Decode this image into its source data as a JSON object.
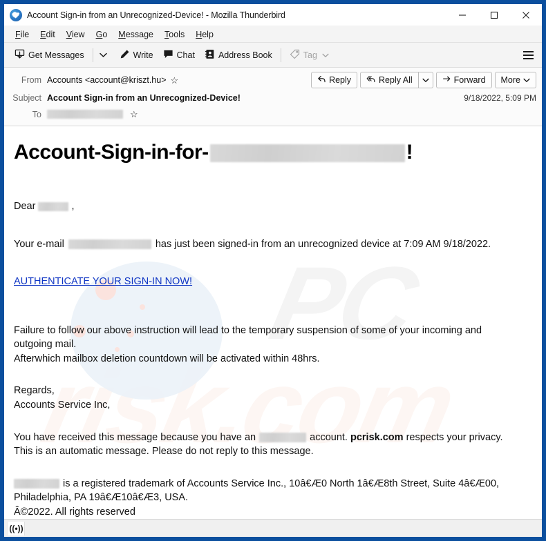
{
  "window": {
    "title": "Account Sign-in from an Unrecognized-Device! - Mozilla Thunderbird",
    "app_icon": "thunderbird-icon",
    "minimize_label": "–",
    "maximize_label": "□",
    "close_label": "✕",
    "frame_color": "#0b4f9e"
  },
  "menubar": {
    "items": [
      {
        "label": "File",
        "accel": "F"
      },
      {
        "label": "Edit",
        "accel": "E"
      },
      {
        "label": "View",
        "accel": "V"
      },
      {
        "label": "Go",
        "accel": "G"
      },
      {
        "label": "Message",
        "accel": "M"
      },
      {
        "label": "Tools",
        "accel": "T"
      },
      {
        "label": "Help",
        "accel": "H"
      }
    ]
  },
  "toolbar": {
    "get_messages": "Get Messages",
    "get_messages_caret": "⌄",
    "write": "Write",
    "chat": "Chat",
    "address_book": "Address Book",
    "tag": "Tag",
    "tag_caret": "⌄",
    "app_menu": "app-menu"
  },
  "message_header": {
    "from_label": "From",
    "from_value": "Accounts <account@kriszt.hu>",
    "subject_label": "Subject",
    "subject_value": "Account Sign-in from an Unrecognized-Device!",
    "to_label": "To",
    "to_value_redacted": true,
    "date": "9/18/2022, 5:09 PM",
    "star_glyph": "☆",
    "actions": {
      "reply": "Reply",
      "reply_all": "Reply All",
      "reply_all_caret": "⌄",
      "forward": "Forward",
      "more": "More",
      "more_caret": "⌄"
    }
  },
  "body": {
    "title_prefix": "Account-Sign-in-for-",
    "title_suffix": "!",
    "title_redacted": true,
    "greeting_prefix": "Dear",
    "greeting_suffix": ",",
    "line_email_prefix": "Your e-mail",
    "line_email_suffix": "has just been signed-in from an unrecognized device at 7:09 AM 9/18/2022.",
    "cta_link": "AUTHENTICATE YOUR SIGN-IN NOW!",
    "warning_line1": "Failure to follow our above instruction will lead to the temporary suspension of some of your incoming and",
    "warning_line2": "outgoing mail.",
    "warning_line3": "Afterwhich mailbox deletion countdown will be activated within 48hrs.",
    "regards": "Regards,",
    "signature": "Accounts Service Inc,",
    "disclaimer_prefix": "You have received this message because you have an",
    "disclaimer_mid": "account.",
    "disclaimer_brand": "pcrisk.com",
    "disclaimer_suffix": "respects your privacy.",
    "disclaimer_line2": "This is an automatic message. Please do not reply to this message.",
    "trademark_suffix": "is a registered trademark of Accounts Service Inc., 10â€Æ0 North 1â€Æ8th Street, Suite 4â€Æ00,",
    "address_line": "Philadelphia, PA 19â€Æ10â€Æ3, USA.",
    "copyright": "Â©2022. All rights reserved",
    "watermark_1": "PC",
    "watermark_2": "risk.com"
  },
  "statusbar": {
    "icon": "broadcast-icon",
    "icon_glyph": "((•))"
  }
}
